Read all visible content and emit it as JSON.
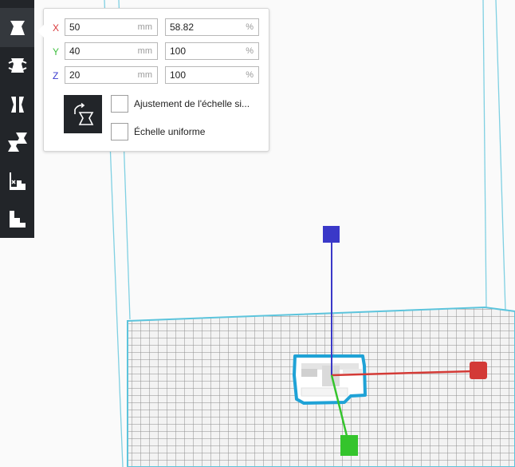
{
  "toolbar": {
    "tools": [
      {
        "name": "scale-tool",
        "icon": "scale-icon",
        "active": true
      },
      {
        "name": "rotate-tool",
        "icon": "rotate-icon",
        "active": false
      },
      {
        "name": "mirror-tool",
        "icon": "mirror-icon",
        "active": false
      },
      {
        "name": "per-model-settings-tool",
        "icon": "per-model-settings-icon",
        "active": false
      },
      {
        "name": "support-blocker-tool",
        "icon": "support-blocker-icon",
        "active": false
      },
      {
        "name": "layer-view-tool",
        "icon": "layer-icon",
        "active": false
      }
    ]
  },
  "scale": {
    "x": {
      "axis": "X",
      "mm": "50",
      "mm_unit": "mm",
      "percent": "58.82",
      "percent_unit": "%",
      "color": "#d9383a"
    },
    "y": {
      "axis": "Y",
      "mm": "40",
      "mm_unit": "mm",
      "percent": "100",
      "percent_unit": "%",
      "color": "#3fbf3f"
    },
    "z": {
      "axis": "Z",
      "mm": "20",
      "mm_unit": "mm",
      "percent": "100",
      "percent_unit": "%",
      "color": "#3b3bcf"
    },
    "snap_scaling_label": "Ajustement de l'échelle si...",
    "uniform_scaling_label": "Échelle uniforme",
    "snap_scaling_checked": false,
    "uniform_scaling_checked": false,
    "lock_icon": "reset-scale-icon"
  },
  "colors": {
    "toolbar_bg": "#222529",
    "build_plate_line": "#8c8c8c",
    "build_volume_edge": "#5cc4dc",
    "selection_outline": "#1fa2d6",
    "x_handle": "#d33a36",
    "y_handle": "#34c42c",
    "z_handle": "#3a38c8"
  }
}
